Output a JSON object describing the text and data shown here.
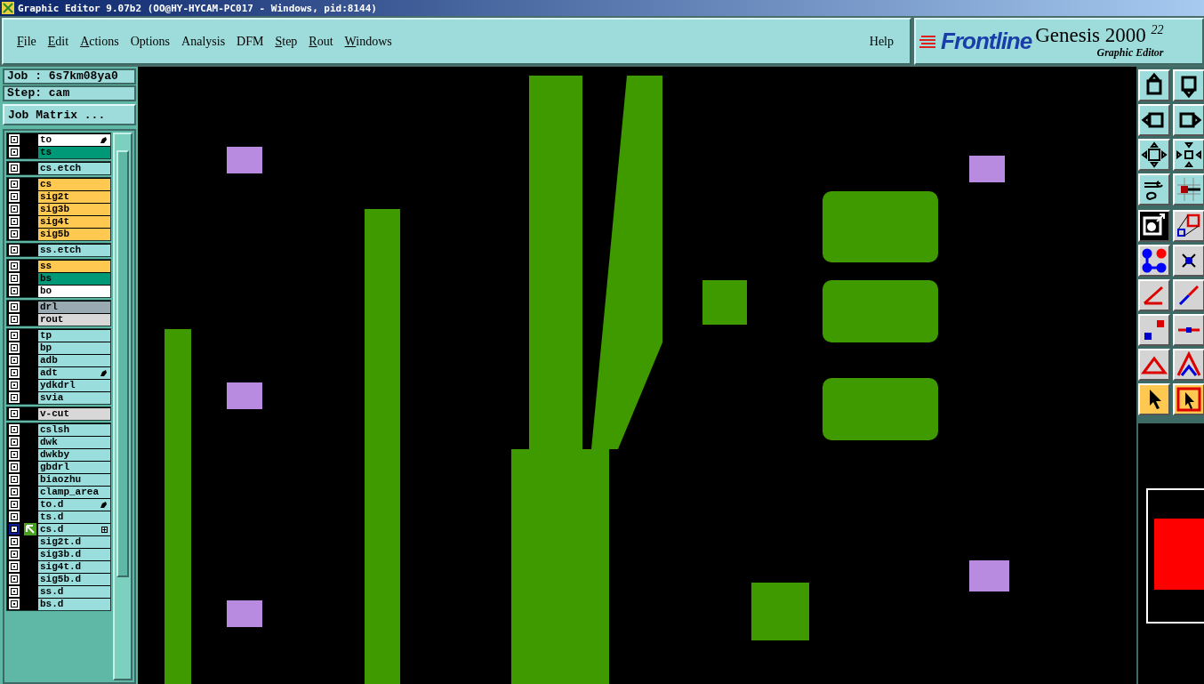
{
  "window": {
    "title": "Graphic Editor 9.07b2 (OO@HY-HYCAM-PC017 - Windows, pid:8144)"
  },
  "menu": [
    {
      "label": "File",
      "mnemonic": true
    },
    {
      "label": "Edit",
      "mnemonic": true
    },
    {
      "label": "Actions",
      "mnemonic": true
    },
    {
      "label": "Options",
      "mnemonic": false
    },
    {
      "label": "Analysis",
      "mnemonic": false
    },
    {
      "label": "DFM",
      "mnemonic": false
    },
    {
      "label": "Step",
      "mnemonic": true
    },
    {
      "label": "Rout",
      "mnemonic": true
    },
    {
      "label": "Windows",
      "mnemonic": true
    }
  ],
  "help": "Help",
  "brand": {
    "logo": "Frontline",
    "product": "Genesis 2000 $^{22}$",
    "subtitle": "Graphic Editor"
  },
  "job": "Job : 6s7km08ya0",
  "step": "Step: cam",
  "job_matrix": "Job Matrix ...",
  "layer_groups": [
    {
      "layers": [
        {
          "name": "to",
          "color": "#ffffff",
          "hand": true,
          "work": false
        },
        {
          "name": "ts",
          "color": "#009977",
          "hand": false,
          "work": false
        }
      ]
    },
    {
      "layers": [
        {
          "name": "cs.etch",
          "color": "#99dddd",
          "hand": false,
          "work": false
        }
      ]
    },
    {
      "layers": [
        {
          "name": "cs",
          "color": "#ffc850",
          "hand": false,
          "work": false
        },
        {
          "name": "sig2t",
          "color": "#ffc850",
          "hand": false,
          "work": false
        },
        {
          "name": "sig3b",
          "color": "#ffc850",
          "hand": false,
          "work": false
        },
        {
          "name": "sig4t",
          "color": "#ffc850",
          "hand": false,
          "work": false
        },
        {
          "name": "sig5b",
          "color": "#ffc850",
          "hand": false,
          "work": false
        }
      ]
    },
    {
      "layers": [
        {
          "name": "ss.etch",
          "color": "#99dddd",
          "hand": false,
          "work": false
        }
      ]
    },
    {
      "layers": [
        {
          "name": "ss",
          "color": "#ffc850",
          "hand": false,
          "work": false
        },
        {
          "name": "bs",
          "color": "#009977",
          "hand": false,
          "work": false
        },
        {
          "name": "bo",
          "color": "#ffffff",
          "hand": false,
          "work": false
        }
      ]
    },
    {
      "layers": [
        {
          "name": "drl",
          "color": "#99aab3",
          "hand": false,
          "work": false
        },
        {
          "name": "rout",
          "color": "#d8d8d8",
          "hand": false,
          "work": false
        }
      ]
    },
    {
      "layers": [
        {
          "name": "tp",
          "color": "#99dddd",
          "hand": false,
          "work": false
        },
        {
          "name": "bp",
          "color": "#99dddd",
          "hand": false,
          "work": false
        },
        {
          "name": "adb",
          "color": "#99dddd",
          "hand": false,
          "work": false
        },
        {
          "name": "adt",
          "color": "#99dddd",
          "hand": true,
          "work": false
        },
        {
          "name": "ydkdrl",
          "color": "#99dddd",
          "hand": false,
          "work": false
        },
        {
          "name": "svia",
          "color": "#99dddd",
          "hand": false,
          "work": false
        }
      ]
    },
    {
      "layers": [
        {
          "name": "v-cut",
          "color": "#d8d8d8",
          "hand": false,
          "work": false
        }
      ]
    },
    {
      "layers": [
        {
          "name": "cslsh",
          "color": "#99dddd",
          "hand": false,
          "work": false
        },
        {
          "name": "dwk",
          "color": "#99dddd",
          "hand": false,
          "work": false
        },
        {
          "name": "dwkby",
          "color": "#99dddd",
          "hand": false,
          "work": false
        },
        {
          "name": "gbdrl",
          "color": "#99dddd",
          "hand": false,
          "work": false
        },
        {
          "name": "biaozhu",
          "color": "#99dddd",
          "hand": false,
          "work": false
        },
        {
          "name": "clamp_area",
          "color": "#99dddd",
          "hand": false,
          "work": false
        },
        {
          "name": "to.d",
          "color": "#99dddd",
          "hand": true,
          "work": false
        },
        {
          "name": "ts.d",
          "color": "#99dddd",
          "hand": false,
          "work": false
        },
        {
          "name": "cs.d",
          "color": "#99dddd",
          "hand": false,
          "work": true
        },
        {
          "name": "sig2t.d",
          "color": "#99dddd",
          "hand": false,
          "work": false
        },
        {
          "name": "sig3b.d",
          "color": "#99dddd",
          "hand": false,
          "work": false
        },
        {
          "name": "sig4t.d",
          "color": "#99dddd",
          "hand": false,
          "work": false
        },
        {
          "name": "sig5b.d",
          "color": "#99dddd",
          "hand": false,
          "work": false
        },
        {
          "name": "ss.d",
          "color": "#99dddd",
          "hand": false,
          "work": false
        },
        {
          "name": "bs.d",
          "color": "#99dddd",
          "hand": false,
          "work": false
        }
      ]
    }
  ],
  "tool_buttons": [
    {
      "kind": "up",
      "selected": false,
      "highlighted": false
    },
    {
      "kind": "down",
      "selected": false,
      "highlighted": false
    },
    {
      "kind": "left",
      "selected": false,
      "highlighted": false
    },
    {
      "kind": "right",
      "selected": false,
      "highlighted": false
    },
    {
      "kind": "expand",
      "selected": false,
      "highlighted": false
    },
    {
      "kind": "shrink",
      "selected": false,
      "highlighted": false
    },
    {
      "kind": "palette",
      "selected": false,
      "highlighted": false
    },
    {
      "kind": "snap",
      "selected": false,
      "highlighted": false
    }
  ],
  "edit_buttons": [
    {
      "kind": "add",
      "selected": true,
      "highlighted": false
    },
    {
      "kind": "copy",
      "selected": false,
      "highlighted": false
    },
    {
      "kind": "nodes",
      "selected": false,
      "highlighted": false
    },
    {
      "kind": "cross",
      "selected": false,
      "highlighted": false
    },
    {
      "kind": "angle",
      "selected": false,
      "highlighted": false
    },
    {
      "kind": "line",
      "selected": false,
      "highlighted": false
    },
    {
      "kind": "boxes",
      "selected": false,
      "highlighted": false
    },
    {
      "kind": "dash",
      "selected": false,
      "highlighted": false
    },
    {
      "kind": "triangle",
      "selected": false,
      "highlighted": false
    },
    {
      "kind": "peak",
      "selected": false,
      "highlighted": false
    },
    {
      "kind": "pointer",
      "selected": false,
      "highlighted": true
    },
    {
      "kind": "pointer-box",
      "selected": false,
      "highlighted": true
    }
  ]
}
